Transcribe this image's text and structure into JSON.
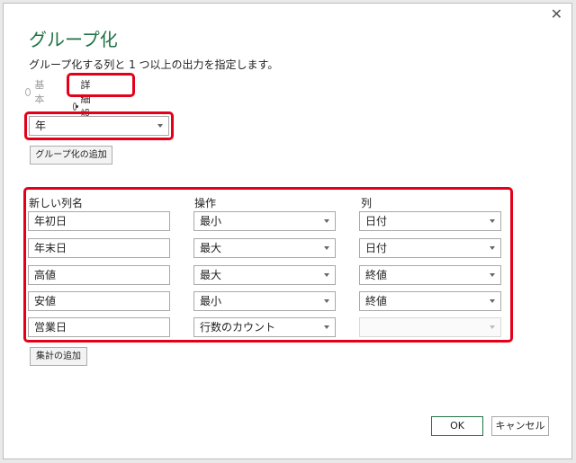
{
  "dialog": {
    "title": "グループ化",
    "subtitle": "グループ化する列と 1 つ以上の出力を指定します。",
    "close_label": "✕"
  },
  "mode": {
    "basic_label": "基本",
    "advanced_label": "詳細設定",
    "selected": "advanced"
  },
  "group_by": {
    "value": "年",
    "add_button_label": "グループ化の追加"
  },
  "aggregations": {
    "headers": {
      "name": "新しい列名",
      "operation": "操作",
      "column": "列"
    },
    "rows": [
      {
        "name": "年初日",
        "operation": "最小",
        "column": "日付"
      },
      {
        "name": "年末日",
        "operation": "最大",
        "column": "日付"
      },
      {
        "name": "高値",
        "operation": "最大",
        "column": "終値"
      },
      {
        "name": "安値",
        "operation": "最小",
        "column": "終値"
      },
      {
        "name": "営業日",
        "operation": "行数のカウント",
        "column": ""
      }
    ],
    "add_button_label": "集計の追加"
  },
  "footer": {
    "ok_label": "OK",
    "cancel_label": "キャンセル"
  },
  "colors": {
    "highlight": "#e4001b",
    "accent": "#217346"
  }
}
